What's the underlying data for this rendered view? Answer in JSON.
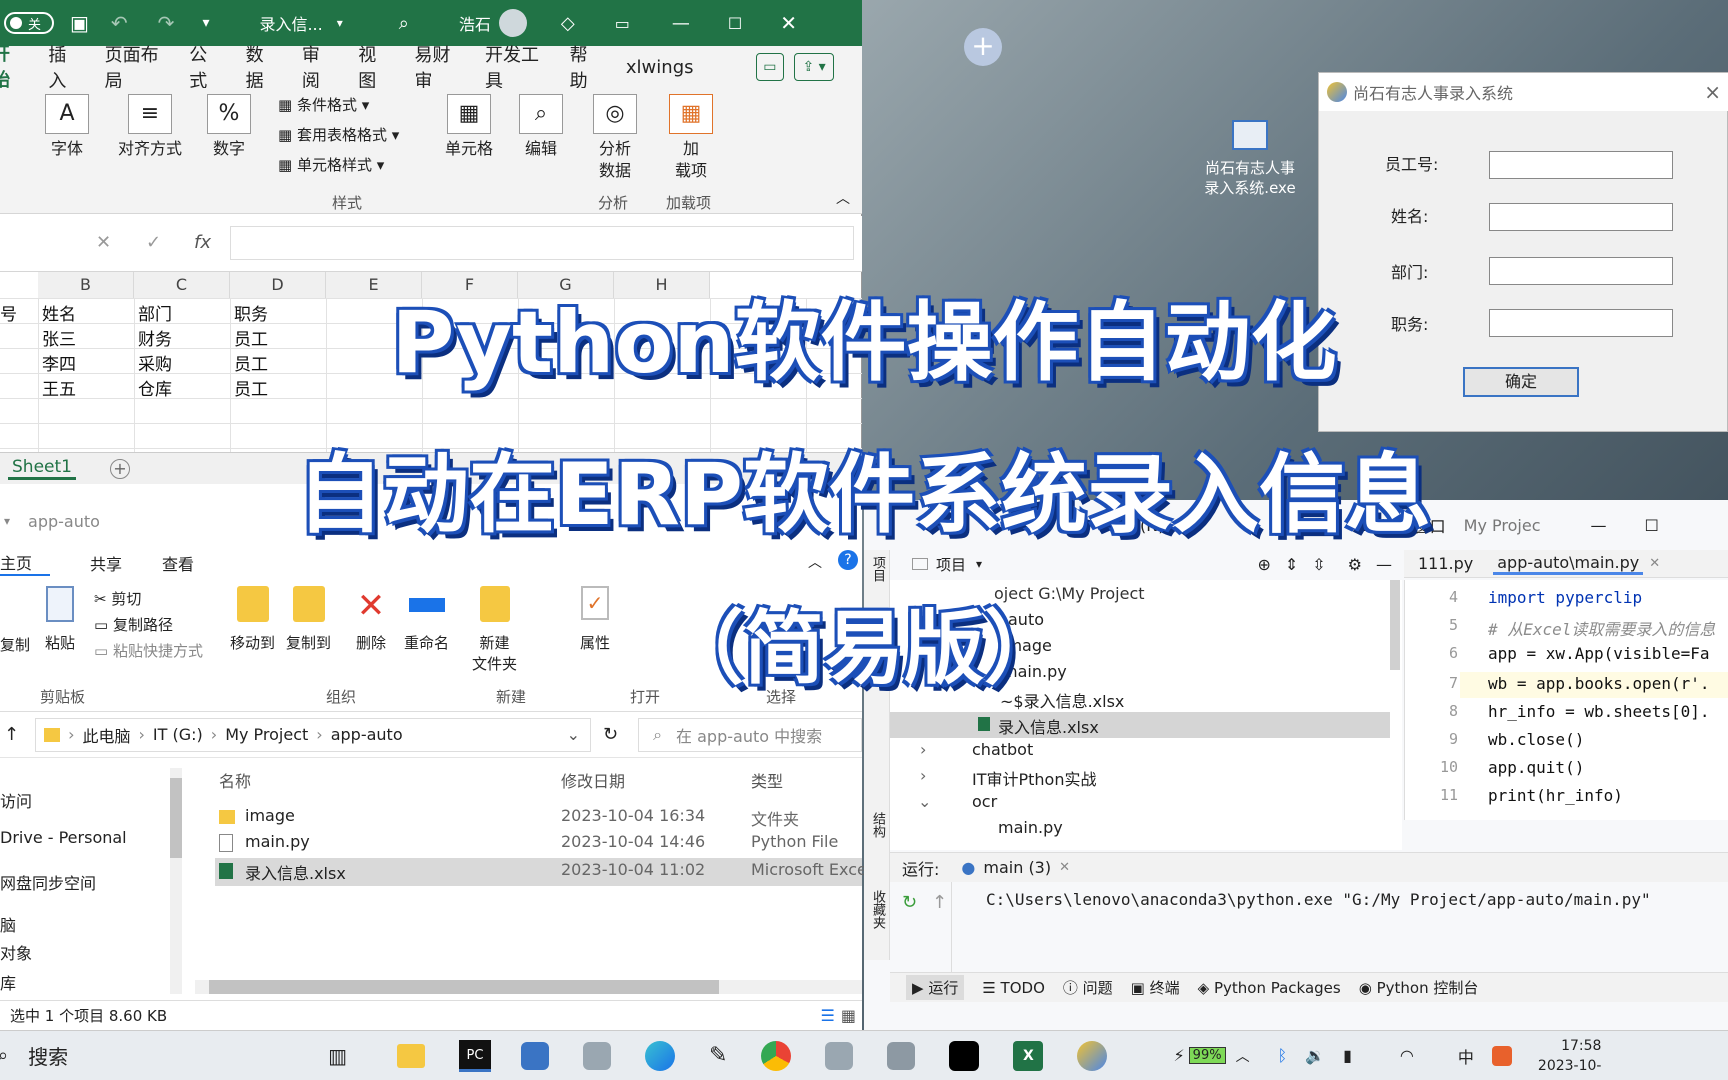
{
  "excel": {
    "autosave_label": "关",
    "title": "录入信...",
    "user": "浩石",
    "menu": [
      "开始",
      "插入",
      "页面布局",
      "公式",
      "数据",
      "审阅",
      "视图",
      "易财审",
      "开发工具",
      "帮助",
      "xlwings"
    ],
    "ribbon": {
      "font": "字体",
      "align": "对齐方式",
      "number": "数字",
      "cond_format": "条件格式",
      "table_format": "套用表格格式",
      "cell_style": "单元格样式",
      "styles_group": "样式",
      "cells": "单元格",
      "edit": "编辑",
      "analysis_l1": "分析",
      "analysis_l2": "数据",
      "analysis_group": "分析",
      "addin_l1": "加",
      "addin_l2": "载项",
      "addin_group": "加载项"
    },
    "fx": "fx",
    "columns": [
      "B",
      "C",
      "D",
      "E",
      "F",
      "G",
      "H"
    ],
    "rows": [
      [
        "姓名",
        "部门",
        "职务"
      ],
      [
        "张三",
        "财务",
        "员工"
      ],
      [
        "李四",
        "采购",
        "员工"
      ],
      [
        "王五",
        "仓库",
        "员工"
      ]
    ],
    "row_prefix": "号",
    "sheet": "Sheet1"
  },
  "explorer": {
    "title": "app-auto",
    "tabs": [
      "主页",
      "共享",
      "查看"
    ],
    "ribbon": {
      "copy": "复制",
      "paste": "粘贴",
      "cut": "剪切",
      "copy_path": "复制路径",
      "paste_shortcut": "粘贴快捷方式",
      "clipboard": "剪贴板",
      "move_to": "移动到",
      "copy_to": "复制到",
      "delete": "删除",
      "rename": "重命名",
      "organize": "组织",
      "new_folder_l1": "新建",
      "new_folder_l2": "文件夹",
      "new_group": "新建",
      "properties": "属性",
      "open_group": "打开",
      "select_group": "选择"
    },
    "breadcrumb": [
      "此电脑",
      "IT (G:)",
      "My Project",
      "app-auto"
    ],
    "search_placeholder": "在 app-auto 中搜索",
    "headers": [
      "名称",
      "修改日期",
      "类型"
    ],
    "files": [
      {
        "name": "image",
        "date": "2023-10-04 16:34",
        "type": "文件夹"
      },
      {
        "name": "main.py",
        "date": "2023-10-04 14:46",
        "type": "Python File"
      },
      {
        "name": "录入信息.xlsx",
        "date": "2023-10-04 11:02",
        "type": "Microsoft Exce"
      }
    ],
    "nav": [
      "访问",
      "Drive - Personal",
      "网盘同步空间",
      "脑",
      "对象",
      "库"
    ],
    "status": "选中 1 个项目  8.60 KB"
  },
  "desktop": {
    "exe_label_l1": "尚石有志人事",
    "exe_label_l2": "录入系统.exe"
  },
  "dialog": {
    "title": "尚石有志人事录入系统",
    "fields": [
      "员工号:",
      "姓名:",
      "部门:",
      "职务:"
    ],
    "ok": "确定"
  },
  "pycharm": {
    "menu": [
      "(N)",
      "工具(T)",
      "VCS(S)",
      "窗口",
      "My Projec"
    ],
    "project_label": "项目",
    "side_tabs": [
      "项目",
      "结构",
      "收藏夹"
    ],
    "tabs": [
      "111.py",
      "app-auto\\main.py"
    ],
    "tree": [
      {
        "t": "oject  G:\\My Project",
        "i": 0
      },
      {
        "t": "auto",
        "i": 1
      },
      {
        "t": "image",
        "i": 1
      },
      {
        "t": "main.py",
        "i": 1
      },
      {
        "t": "~$录入信息.xlsx",
        "i": 2
      },
      {
        "t": "录入信息.xlsx",
        "i": 2
      },
      {
        "t": "chatbot",
        "i": 1
      },
      {
        "t": "IT审计Pthon实战",
        "i": 1
      },
      {
        "t": "ocr",
        "i": 1
      },
      {
        "t": "main.py",
        "i": 2
      }
    ],
    "line_numbers": [
      "4",
      "5",
      "6",
      "7",
      "8",
      "9",
      "10",
      "11"
    ],
    "code": [
      "import pyperclip",
      "# 从Excel读取需要录入的信息",
      "app = xw.App(visible=Fa",
      "wb = app.books.open(r'.",
      "hr_info = wb.sheets[0].",
      "wb.close()",
      "app.quit()",
      "print(hr_info)"
    ],
    "run_label": "运行:",
    "run_tab": "main (3)",
    "run_output": "C:\\Users\\lenovo\\anaconda3\\python.exe \"G:/My Project/app-auto/main.py\"",
    "bottom_tabs": [
      "运行",
      "TODO",
      "问题",
      "终端",
      "Python Packages",
      "Python 控制台"
    ]
  },
  "overlay": {
    "line1": "Python软件操作自动化",
    "line2": "自动在ERP软件系统录入信息",
    "line3": "（简易版）"
  },
  "taskbar": {
    "search": "搜索",
    "battery": "99%",
    "ime": "中",
    "time": "17:58",
    "date": "2023-10-"
  }
}
